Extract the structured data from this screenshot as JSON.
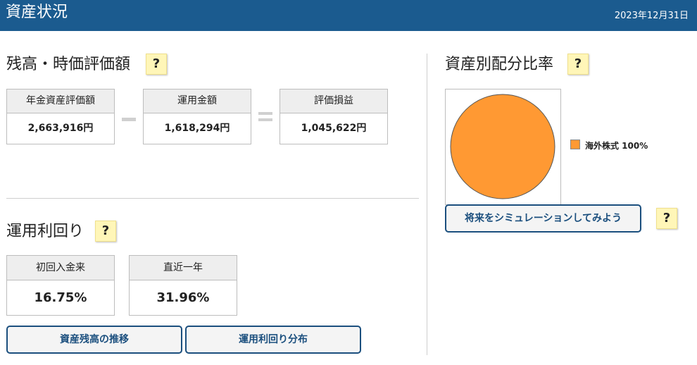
{
  "header": {
    "title": "資産状況",
    "date": "2023年12月31日"
  },
  "balance": {
    "title": "残高・時価評価額",
    "help": "?",
    "cards": [
      {
        "label": "年金資産評価額",
        "value": "2,663,916円"
      },
      {
        "label": "運用金額",
        "value": "1,618,294円"
      },
      {
        "label": "評価損益",
        "value": "1,045,622円"
      }
    ]
  },
  "yield": {
    "title": "運用利回り",
    "help": "?",
    "cards": [
      {
        "label": "初回入金来",
        "value": "16.75%"
      },
      {
        "label": "直近一年",
        "value": "31.96%"
      }
    ]
  },
  "buttons": {
    "asset_history": "資産残高の推移",
    "yield_distribution": "運用利回り分布",
    "simulate": "将来をシミュレーションしてみよう",
    "simulate_help": "?"
  },
  "allocation": {
    "title": "資産別配分比率",
    "help": "?"
  },
  "chart_data": {
    "type": "pie",
    "slices": [
      {
        "label": "海外株式",
        "value": 100,
        "display": "海外株式 100%",
        "color": "#ff9933"
      }
    ],
    "legend": "right"
  }
}
